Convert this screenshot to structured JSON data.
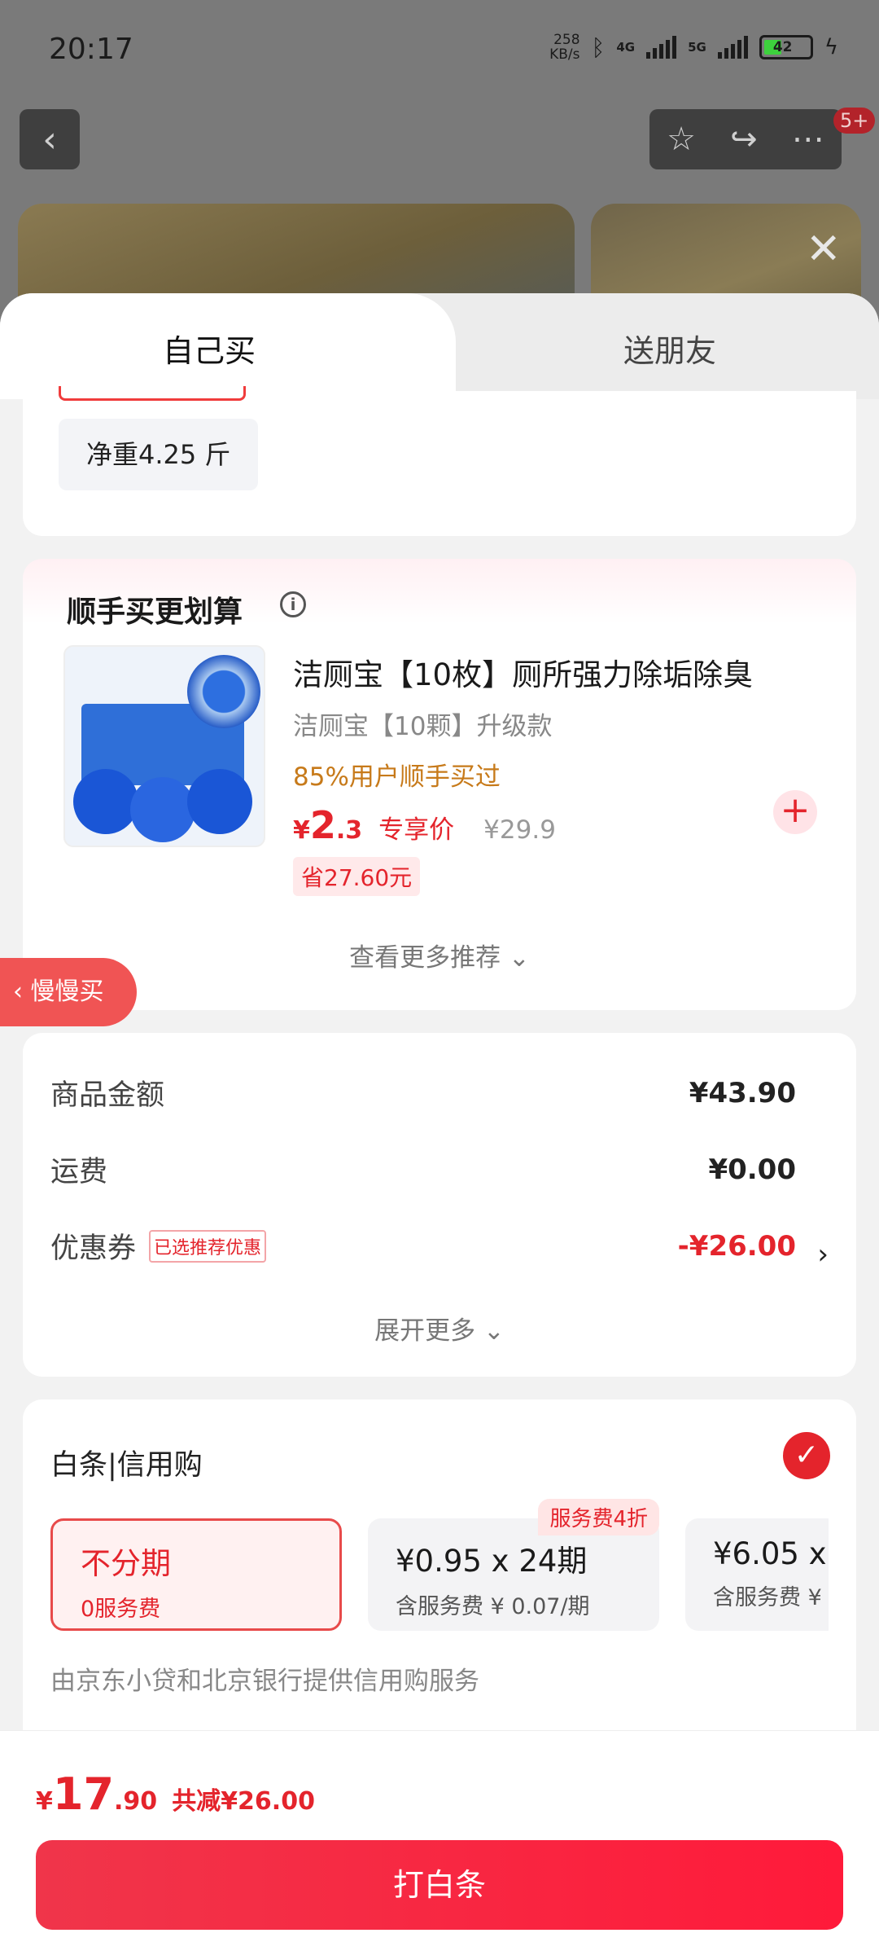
{
  "status_bar": {
    "time": "20:17",
    "speed": "258",
    "speed_unit": "KB/s",
    "net1": "4G",
    "net2": "5G",
    "battery": "42"
  },
  "background_badge": "5+",
  "tabs": {
    "self": "自己买",
    "friend": "送朋友"
  },
  "spec": {
    "chip": "净重4.25 斤"
  },
  "addon": {
    "title": "顺手买更划算",
    "product_name": "洁厕宝【10枚】厕所强力除垢除臭",
    "product_sub": "洁厕宝【10颗】升级款",
    "social_proof": "85%用户顺手买过",
    "price_yen": "¥",
    "price_int": "2",
    "price_dec": ".3",
    "price_tag": "专享价",
    "original_price": "¥29.9",
    "save": "省27.60元",
    "more": "查看更多推荐 ⌄"
  },
  "slow_buy": "慢慢买",
  "summary": {
    "goods_label": "商品金额",
    "goods_value": "¥43.90",
    "shipping_label": "运费",
    "shipping_value": "¥0.00",
    "coupon_label": "优惠券",
    "coupon_tag": "已选推荐优惠",
    "coupon_value": "-¥26.00",
    "expand": "展开更多 ⌄"
  },
  "credit": {
    "title": "白条|信用购",
    "plans": [
      {
        "main": "不分期",
        "sub": "0服务费",
        "badge": ""
      },
      {
        "main": "¥0.95 x 24期",
        "sub": "含服务费 ¥ 0.07/期",
        "badge": "服务费4折"
      },
      {
        "main": "¥6.05 x",
        "sub": "含服务费 ¥ (",
        "badge": ""
      }
    ],
    "note": "由京东小贷和北京银行提供信用购服务"
  },
  "footer": {
    "total_yen": "¥",
    "total_int": "17",
    "total_dec": ".90",
    "reduce": "共减¥26.00",
    "pay_button": "打白条"
  },
  "colors": {
    "accent": "#e4242c",
    "button_gradient_start": "#f0354a",
    "button_gradient_end": "#ff1a3a"
  }
}
